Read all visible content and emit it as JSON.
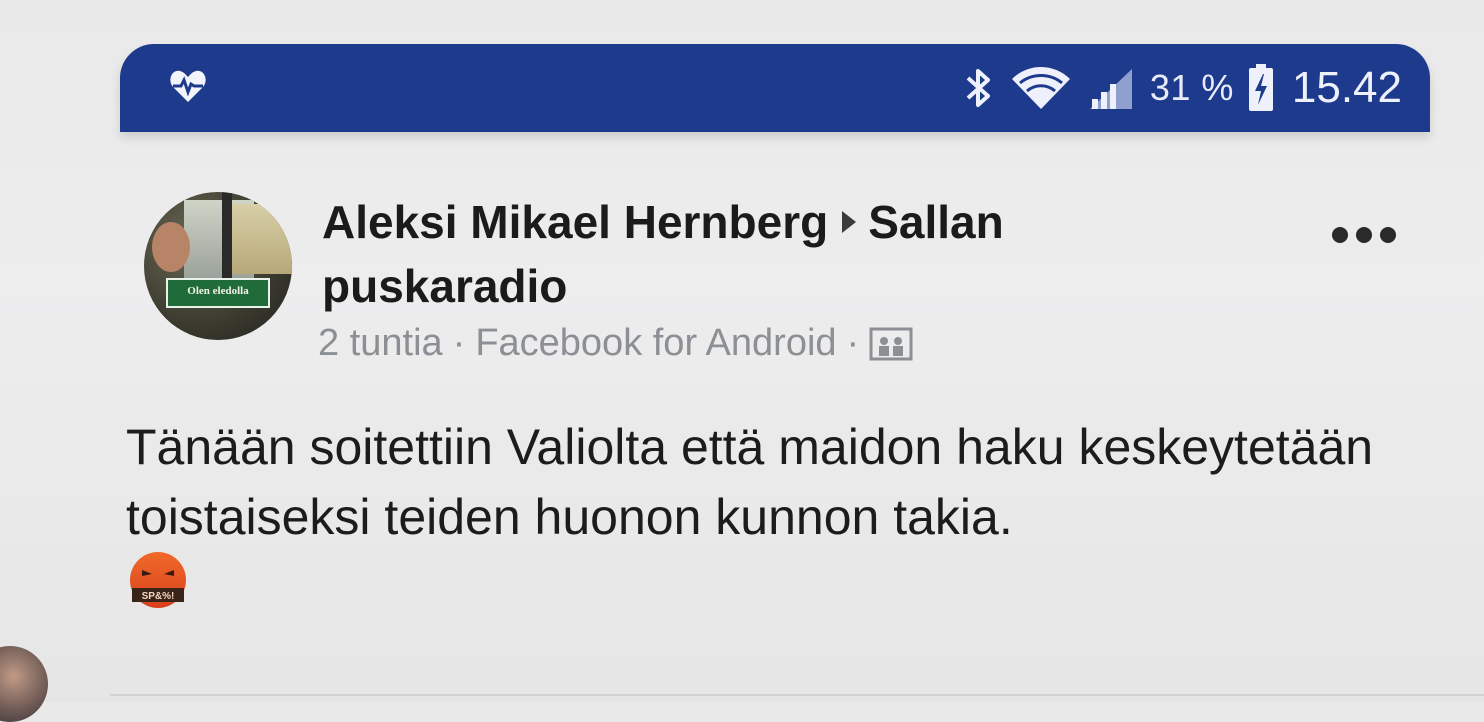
{
  "status_bar": {
    "left_icon": "heart-pulse-icon",
    "icons": [
      "bluetooth-icon",
      "wifi-icon",
      "signal-icon",
      "battery-charging-icon"
    ],
    "battery_percent": "31 %",
    "time": "15.42",
    "background_color": "#1e3a8d"
  },
  "post": {
    "author": "Aleksi Mikael Hernberg",
    "group": "Sallan puskaradio",
    "meta": {
      "time_ago": "2 tuntia",
      "separator": "·",
      "source": "Facebook for Android",
      "audience_icon": "group-audience-icon"
    },
    "avatar_text": "Olen eledolla",
    "more_icon": "more-options-icon",
    "body_text": "Tänään soitettiin Valiolta että maidon haku keskeytetään toistaiseksi teiden huonon kunnon takia.",
    "emoji_icon": "angry-face-icon",
    "emoji_text": "SP&%!"
  }
}
